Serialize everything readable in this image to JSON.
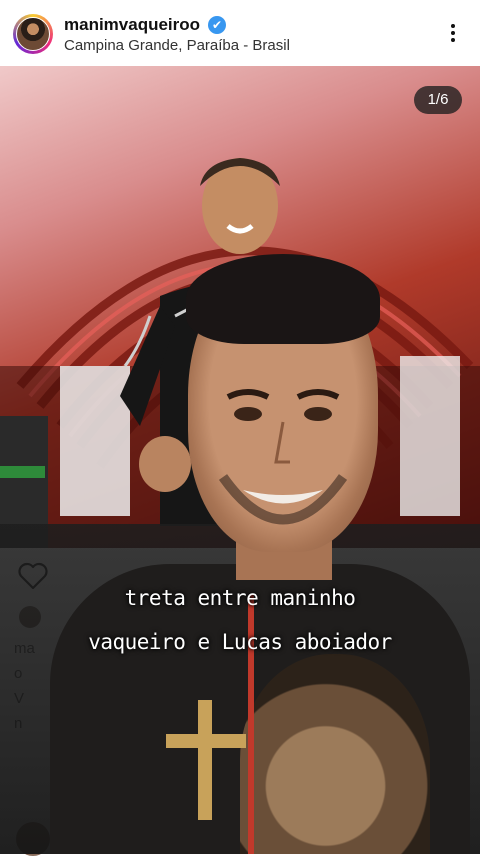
{
  "header": {
    "username": "manimvaqueiroo",
    "verified_glyph": "✔",
    "location": "Campina Grande, Paraíba - Brasil",
    "more_icon": "more-vertical-icon"
  },
  "post": {
    "counter": "1/6",
    "side_letters": [
      "ma",
      "o",
      "V",
      "n"
    ]
  },
  "video_overlay": {
    "caption_line_1": "treta entre maninho",
    "caption_line_2": "vaqueiro e Lucas aboiador"
  },
  "colors": {
    "verified_blue": "#3897f0",
    "counter_bg": "#1e1e1e",
    "stage_red": "#b03a2a"
  }
}
